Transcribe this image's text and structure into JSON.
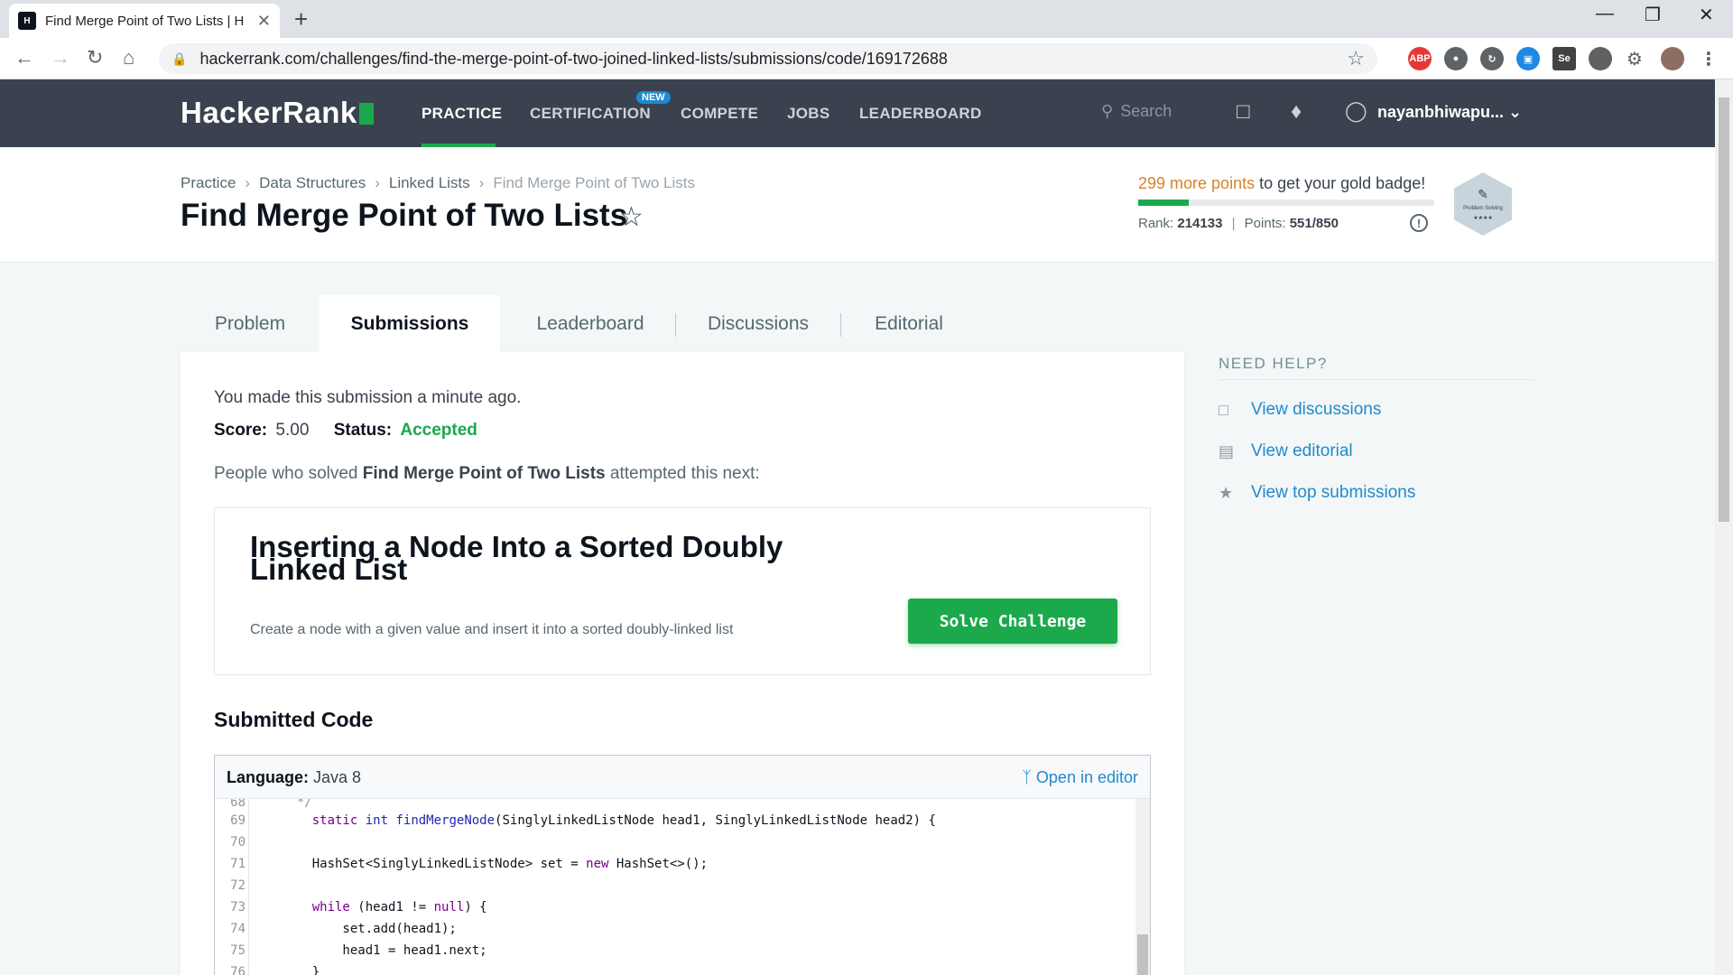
{
  "browser": {
    "tab_title": "Find Merge Point of Two Lists | H",
    "tab_close": "✕",
    "new_tab": "+",
    "url": "hackerrank.com/challenges/find-the-merge-point-of-two-joined-linked-lists/submissions/code/169172688",
    "ext_abp": "ABP",
    "ext_se": "Se"
  },
  "header": {
    "logo": "HackerRank",
    "nav": [
      "PRACTICE",
      "CERTIFICATION",
      "COMPETE",
      "JOBS",
      "LEADERBOARD"
    ],
    "new_badge": "NEW",
    "search_placeholder": "Search",
    "username": "nayanbhiwapu..."
  },
  "breadcrumb": [
    "Practice",
    "Data Structures",
    "Linked Lists",
    "Find Merge Point of Two Lists"
  ],
  "title": "Find Merge Point of Two Lists",
  "badge": {
    "points_more": "299 more points",
    "text_rest": " to get your gold badge!",
    "progress": 0.17,
    "rank_label": "Rank:",
    "rank": "214133",
    "points_label": "Points:",
    "points": "551/850",
    "hex_label": "Problem Solving",
    "hex_stars": "★★★★"
  },
  "tabs": [
    "Problem",
    "Submissions",
    "Leaderboard",
    "Discussions",
    "Editorial"
  ],
  "submission": {
    "time_text": "You made this submission a minute ago.",
    "score_label": "Score:",
    "score": "5.00",
    "status_label": "Status:",
    "status": "Accepted",
    "people_pre": "People who solved ",
    "people_title": "Find Merge Point of Two Lists",
    "people_post": " attempted this next:"
  },
  "recommendation": {
    "title": "Inserting a Node Into a Sorted Doubly Linked List",
    "description": "Create a node with a given value and insert it into a sorted doubly-linked list",
    "button": "Solve Challenge"
  },
  "code": {
    "heading": "Submitted Code",
    "language_label": "Language:",
    "language": "Java 8",
    "open_editor": "Open in editor",
    "lines": [
      {
        "n": "68",
        "t": "  */"
      },
      {
        "n": "69",
        "t": ""
      },
      {
        "n": "70",
        "t": ""
      },
      {
        "n": "71",
        "t": ""
      },
      {
        "n": "72",
        "t": ""
      },
      {
        "n": "73",
        "t": ""
      },
      {
        "n": "74",
        "t": "        set.add(head1);"
      },
      {
        "n": "75",
        "t": "        head1 = head1.next;"
      },
      {
        "n": "76",
        "t": "    }"
      }
    ],
    "line69": {
      "kw1": "static",
      "kw2": "int",
      "fn": "findMergeNode",
      "rest": "(SinglyLinkedListNode head1, SinglyLinkedListNode head2) {"
    },
    "line71": {
      "pre": "    HashSet<SinglyLinkedListNode> set = ",
      "kw": "new",
      "post": " HashSet<>();"
    },
    "line73": {
      "kw": "while",
      "mid": " (head1 != ",
      "kw2": "null",
      "post": ") {"
    }
  },
  "help": {
    "heading": "NEED HELP?",
    "items": [
      "View discussions",
      "View editorial",
      "View top submissions"
    ]
  }
}
